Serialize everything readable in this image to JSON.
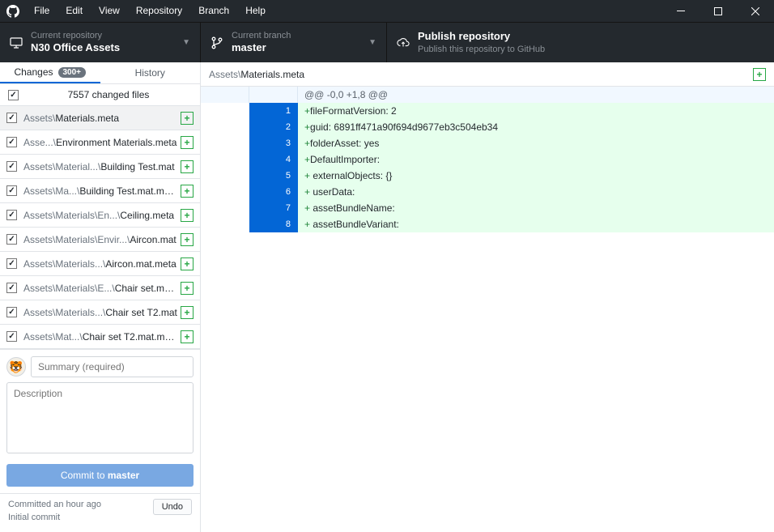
{
  "menu": [
    "File",
    "Edit",
    "View",
    "Repository",
    "Branch",
    "Help"
  ],
  "toolbar": {
    "repo": {
      "label": "Current repository",
      "value": "N30 Office Assets"
    },
    "branch": {
      "label": "Current branch",
      "value": "master"
    },
    "publish": {
      "label": "Publish repository",
      "value": "Publish this repository to GitHub"
    }
  },
  "tabs": {
    "changes": {
      "label": "Changes",
      "badge": "300+"
    },
    "history": {
      "label": "History"
    }
  },
  "changes_header": "7557 changed files",
  "files": [
    {
      "dim": "Assets\\",
      "name": "Materials.meta",
      "selected": true
    },
    {
      "dim": "Asse...\\",
      "name": "Environment Materials.meta"
    },
    {
      "dim": "Assets\\Material...\\",
      "name": "Building Test.mat"
    },
    {
      "dim": "Assets\\Ma...\\",
      "name": "Building Test.mat.meta"
    },
    {
      "dim": "Assets\\Materials\\En...\\",
      "name": "Ceiling.meta"
    },
    {
      "dim": "Assets\\Materials\\Envir...\\",
      "name": "Aircon.mat"
    },
    {
      "dim": "Assets\\Materials...\\",
      "name": "Aircon.mat.meta"
    },
    {
      "dim": "Assets\\Materials\\E...\\",
      "name": "Chair set.meta"
    },
    {
      "dim": "Assets\\Materials...\\",
      "name": "Chair set T2.mat"
    },
    {
      "dim": "Assets\\Mat...\\",
      "name": "Chair set T2.mat.meta"
    }
  ],
  "commit": {
    "summary_placeholder": "Summary (required)",
    "desc_placeholder": "Description",
    "button_prefix": "Commit to ",
    "button_branch": "master"
  },
  "last_commit": {
    "time": "Committed an hour ago",
    "msg": "Initial commit",
    "undo": "Undo"
  },
  "diff": {
    "path_dim": "Assets\\",
    "path_name": "Materials.meta",
    "hunk_header": "@@ -0,0 +1,8 @@",
    "lines": [
      {
        "n": "1",
        "text": "fileFormatVersion: 2"
      },
      {
        "n": "2",
        "text": "guid: 6891ff471a90f694d9677eb3c504eb34"
      },
      {
        "n": "3",
        "text": "folderAsset: yes"
      },
      {
        "n": "4",
        "text": "DefaultImporter:"
      },
      {
        "n": "5",
        "text": "  externalObjects: {}"
      },
      {
        "n": "6",
        "text": "  userData:"
      },
      {
        "n": "7",
        "text": "  assetBundleName:"
      },
      {
        "n": "8",
        "text": "  assetBundleVariant:"
      }
    ]
  }
}
